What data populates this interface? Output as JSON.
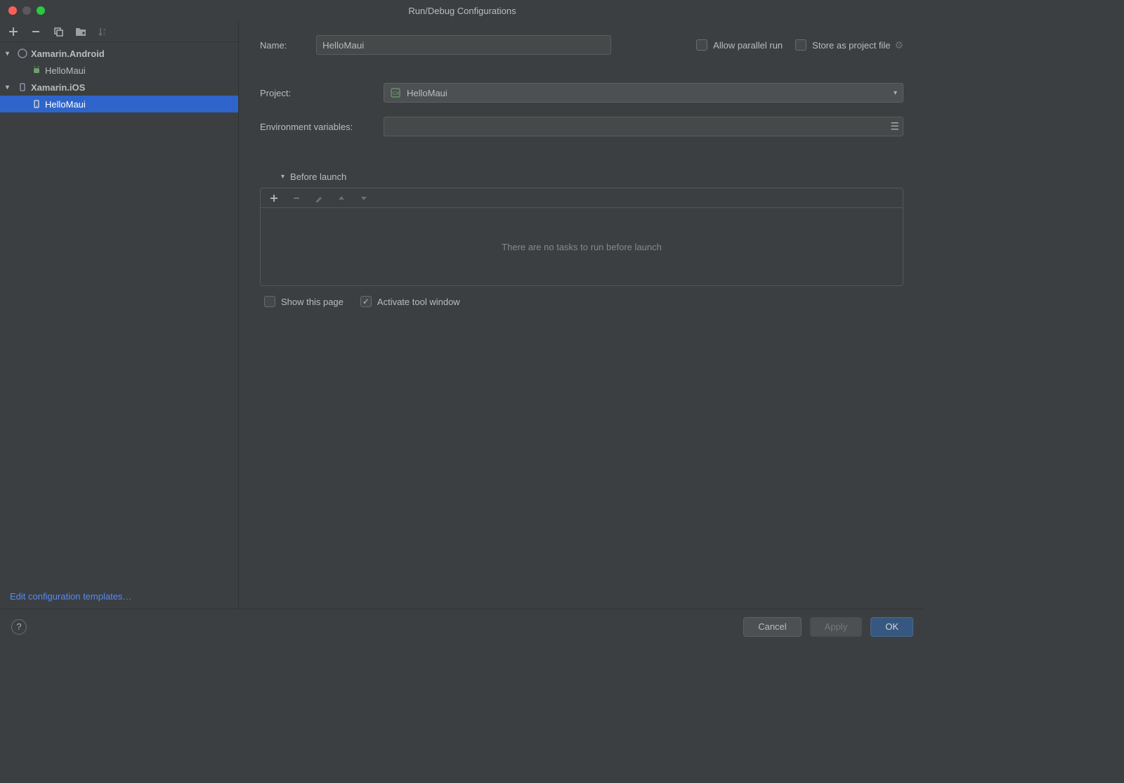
{
  "window": {
    "title": "Run/Debug Configurations"
  },
  "sidebar": {
    "groups": [
      {
        "label": "Xamarin.Android",
        "children": [
          {
            "label": "HelloMaui",
            "selected": false,
            "iconColor": "#6ba06b"
          }
        ]
      },
      {
        "label": "Xamarin.iOS",
        "children": [
          {
            "label": "HelloMaui",
            "selected": true,
            "iconColor": "#8a8fa0"
          }
        ]
      }
    ],
    "footer_link": "Edit configuration templates…"
  },
  "form": {
    "name_label": "Name:",
    "name_value": "HelloMaui",
    "allow_parallel_label": "Allow parallel run",
    "allow_parallel_checked": false,
    "store_as_file_label": "Store as project file",
    "store_as_file_checked": false,
    "project_label": "Project:",
    "project_value": "HelloMaui",
    "env_label": "Environment variables:",
    "env_value": "",
    "before_launch_label": "Before launch",
    "before_empty_text": "There are no tasks to run before launch",
    "show_this_page_label": "Show this page",
    "show_this_page_checked": false,
    "activate_tool_label": "Activate tool window",
    "activate_tool_checked": true
  },
  "footer": {
    "cancel": "Cancel",
    "apply": "Apply",
    "ok": "OK"
  }
}
